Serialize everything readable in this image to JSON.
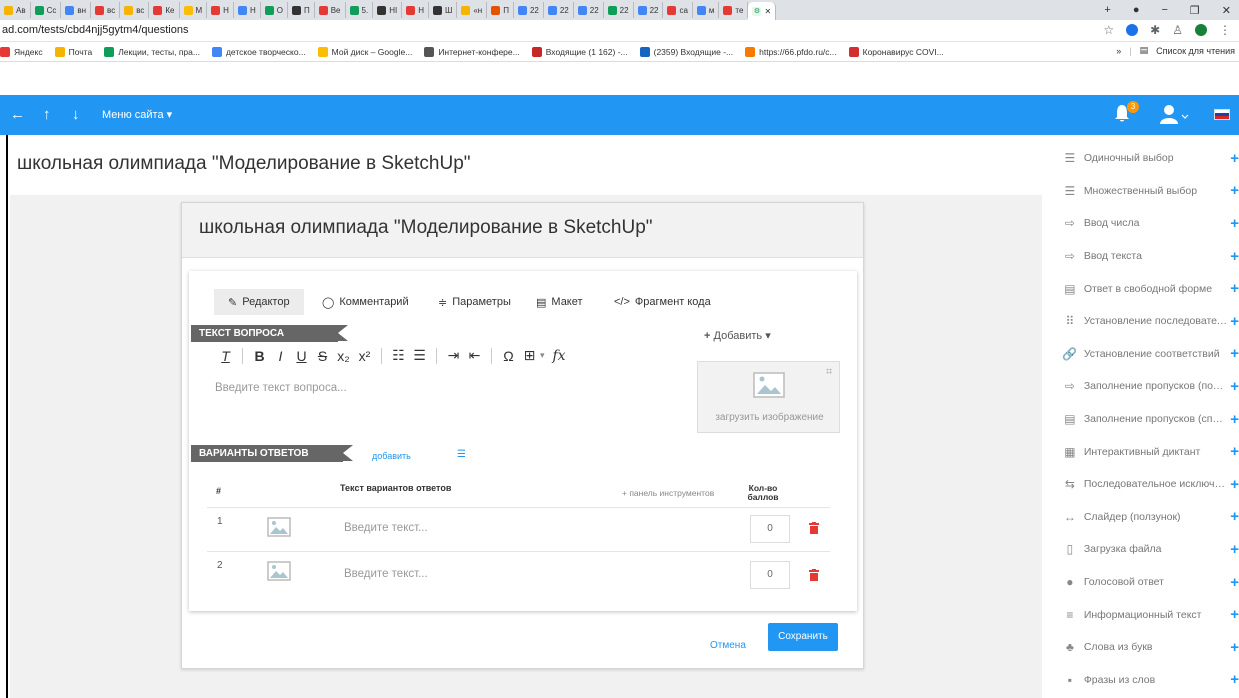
{
  "browser": {
    "tabs": [
      "Ав",
      "Сс",
      "вн",
      "вс",
      "вс",
      "Ке",
      "М",
      "Н",
      "Н",
      "О",
      "П",
      "Ве",
      "5.",
      "HI",
      "Н",
      "Ш",
      "«н",
      "П",
      "22",
      "22",
      "22",
      "22",
      "22",
      "са",
      "м",
      "те"
    ],
    "tab_colors": [
      "#f4b400",
      "#0f9d58",
      "#4285f4",
      "#e53935",
      "#f4b400",
      "#e53935",
      "#fbbc04",
      "#e53935",
      "#4285f4",
      "#0f9d58",
      "#333333",
      "#e53935",
      "#0f9d58",
      "#333333",
      "#e53935",
      "#333333",
      "#f4b400",
      "#e65100",
      "#4285f4",
      "#4285f4",
      "#4285f4",
      "#0f9d58",
      "#4285f4",
      "#e53935",
      "#4285f4",
      "#e53935"
    ],
    "url": "ad.com/tests/cbd4njj5gytm4/questions",
    "bookmarks": [
      {
        "label": "Яндекс",
        "color": "#e53935"
      },
      {
        "label": "Почта",
        "color": "#f4b400"
      },
      {
        "label": "Лекции, тесты, пра...",
        "color": "#0f9d58"
      },
      {
        "label": "детское творческо...",
        "color": "#4285f4"
      },
      {
        "label": "Мой диск – Google...",
        "color": "#fbbc04"
      },
      {
        "label": "Интернет-конфере...",
        "color": "#555555"
      },
      {
        "label": "Входящие (1 162) -...",
        "color": "#c62828"
      },
      {
        "label": "(2359) Входящие -...",
        "color": "#1565c0"
      },
      {
        "label": "https://66.pfdo.ru/c...",
        "color": "#f57c00"
      },
      {
        "label": "Коронавирус COVI...",
        "color": "#d32f2f"
      }
    ],
    "reading_list": "Список для чтения",
    "more": "»"
  },
  "appbar": {
    "menu_label": "Меню сайта",
    "notifications": "3",
    "color": "#2196f3"
  },
  "page": {
    "title": "школьная олимпиада \"Моделирование в SketchUp\""
  },
  "card": {
    "title": "школьная олимпиада \"Моделирование в SketchUp\"",
    "tabs": [
      {
        "icon": "✎",
        "label": "Редактор"
      },
      {
        "icon": "◯",
        "label": "Комментарий"
      },
      {
        "icon": "≑",
        "label": "Параметры"
      },
      {
        "icon": "▤",
        "label": "Макет"
      },
      {
        "icon": "</>",
        "label": "Фрагмент кода"
      }
    ],
    "question_section": "ТЕКСТ ВОПРОСА",
    "add_menu": "Добавить",
    "question_placeholder": "Введите текст вопроса...",
    "upload_image": "загрузить изображение",
    "answers_section": "ВАРИАНТЫ ОТВЕТОВ",
    "add_answer": "добавить",
    "table": {
      "col_num": "#",
      "col_text": "Текст вариантов ответов",
      "col_panel": "+ панель инструментов",
      "col_score": "Кол-во баллов",
      "rows": [
        {
          "num": "1",
          "placeholder": "Введите текст...",
          "score": "0"
        },
        {
          "num": "2",
          "placeholder": "Введите текст...",
          "score": "0"
        }
      ]
    },
    "cancel": "Отмена",
    "save": "Сохранить"
  },
  "question_types": [
    {
      "icon": "list-radio-icon",
      "glyph": "☰",
      "label": "Одиночный выбор"
    },
    {
      "icon": "list-check-icon",
      "glyph": "☰",
      "label": "Множественный выбор"
    },
    {
      "icon": "input-number-icon",
      "glyph": "⇨",
      "label": "Ввод числа"
    },
    {
      "icon": "input-text-icon",
      "glyph": "⇨",
      "label": "Ввод текста"
    },
    {
      "icon": "free-form-icon",
      "glyph": "▤",
      "label": "Ответ в свободной форме"
    },
    {
      "icon": "sequence-icon",
      "glyph": "⠿",
      "label": "Установление последовательности"
    },
    {
      "icon": "link-icon",
      "glyph": "🔗",
      "label": "Установление соответствий"
    },
    {
      "icon": "fill-gaps-icon",
      "glyph": "⇨",
      "label": "Заполнение пропусков (поле ввода)"
    },
    {
      "icon": "fill-gaps-list-icon",
      "glyph": "▤",
      "label": "Заполнение пропусков (список)"
    },
    {
      "icon": "grid-icon",
      "glyph": "▦",
      "label": "Интерактивный диктант"
    },
    {
      "icon": "swap-icon",
      "glyph": "⇆",
      "label": "Последовательное исключение"
    },
    {
      "icon": "slider-icon",
      "glyph": "↔",
      "label": "Слайдер (ползунок)"
    },
    {
      "icon": "file-icon",
      "glyph": "▯",
      "label": "Загрузка файла"
    },
    {
      "icon": "microphone-icon",
      "glyph": "●",
      "label": "Голосовой ответ"
    },
    {
      "icon": "info-text-icon",
      "glyph": "≡",
      "label": "Информационный текст"
    },
    {
      "icon": "letters-icon",
      "glyph": "♣",
      "label": "Слова из букв"
    },
    {
      "icon": "phrases-icon",
      "glyph": "▪",
      "label": "Фразы из слов"
    }
  ]
}
